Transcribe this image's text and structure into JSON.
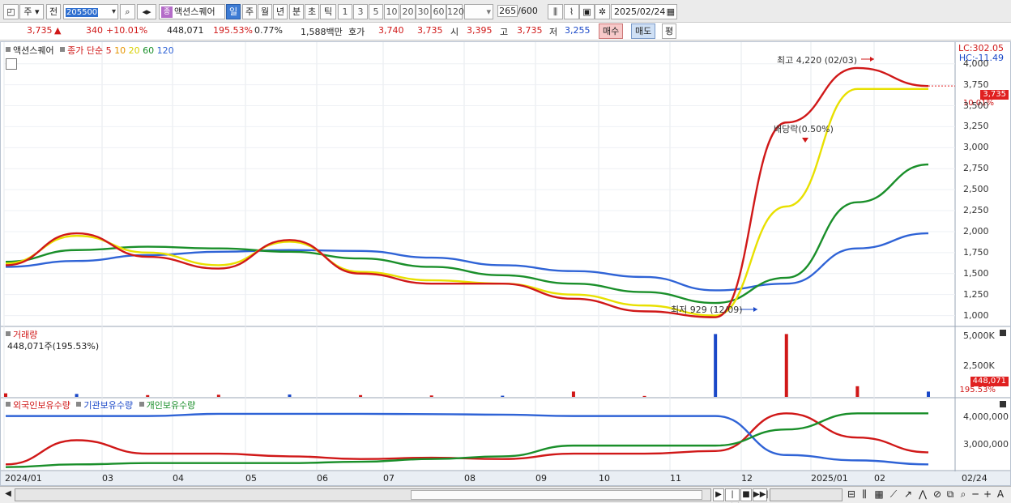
{
  "toolbar": {
    "market_label": "주",
    "prev_label": "전",
    "stock_code": "205500",
    "stock_name_tag": "종",
    "stock_name": "액션스퀘어",
    "periods": [
      "일",
      "주",
      "월",
      "년",
      "분",
      "초",
      "틱"
    ],
    "active_period": "일",
    "intervals": [
      "1",
      "3",
      "5",
      "10",
      "20",
      "30",
      "60",
      "120"
    ],
    "bar_count": "265",
    "bar_total": "/600",
    "date": "2025/02/24"
  },
  "quote": {
    "price": "3,735",
    "change": "340",
    "change_pct": "+10.01%",
    "volume": "448,071",
    "volume_ratio": "195.53%",
    "turnover_pct": "0.77%",
    "trade_value": "1,588백만",
    "hoga_label": "호가",
    "ask": "3,740",
    "bid": "3,735",
    "open_label": "시",
    "open": "3,395",
    "high_label": "고",
    "high": "3,735",
    "low_label": "저",
    "low": "3,255",
    "buy_label": "매수",
    "sell_label": "매도",
    "eval_label": "평"
  },
  "price_panel": {
    "stock_label": "액션스퀘어",
    "series_label": "종가 단순",
    "ma_labels": [
      {
        "label": "5",
        "color": "#d01818"
      },
      {
        "label": "10",
        "color": "#e59400"
      },
      {
        "label": "20",
        "color": "#e8e000"
      },
      {
        "label": "60",
        "color": "#1a8f2a"
      },
      {
        "label": "120",
        "color": "#2f63d6"
      }
    ],
    "lc_label": "LC:302.05",
    "hc_label": "HC:-11.49",
    "price_tag": "3,735",
    "pct_tag": "10.01%",
    "high_annotation": "최고 4,220 (02/03)",
    "low_annotation": "최저 929 (12/09)",
    "dividend_annotation": "배당락(0.50%)",
    "y_ticks": [
      "4,000",
      "3,750",
      "3,500",
      "3,250",
      "3,000",
      "2,750",
      "2,500",
      "2,250",
      "2,000",
      "1,750",
      "1,500",
      "1,250",
      "1,000"
    ]
  },
  "volume_panel": {
    "title": "거래량",
    "value_label": "448,071주(195.53%)",
    "y_ticks": [
      "5,000K",
      "2,500K"
    ],
    "tag_value": "448,071",
    "tag_pct": "195.53%"
  },
  "holding_panel": {
    "legend": [
      {
        "label": "외국인보유수량",
        "color": "#d01818"
      },
      {
        "label": "기관보유수량",
        "color": "#2f63d6"
      },
      {
        "label": "개인보유수량",
        "color": "#1a8f2a"
      }
    ],
    "y_ticks": [
      "4,000,000",
      "3,000,000"
    ]
  },
  "x_axis": {
    "labels": [
      "2024/01",
      "03",
      "04",
      "05",
      "06",
      "07",
      "08",
      "09",
      "10",
      "11",
      "12",
      "2025/01",
      "02"
    ],
    "end_label": "02/24"
  },
  "nav": {
    "arrows": [
      "◀",
      "▶",
      "|◀◀",
      "■",
      "▶▶|"
    ],
    "tools": [
      "─",
      "+",
      "A"
    ]
  },
  "chart_data": [
    {
      "type": "line",
      "title": "",
      "description_series": "daily close with moving averages",
      "x": [
        "2024/01",
        "03",
        "04",
        "05",
        "06",
        "07",
        "08",
        "09",
        "10",
        "11",
        "12",
        "2025/01",
        "02",
        "02/24"
      ],
      "series": [
        {
          "name": "5",
          "values": [
            1600,
            1980,
            1700,
            1560,
            1900,
            1500,
            1380,
            1380,
            1200,
            1050,
            980,
            3300,
            3950,
            3735
          ]
        },
        {
          "name": "20",
          "values": [
            1620,
            1950,
            1750,
            1600,
            1880,
            1520,
            1420,
            1380,
            1250,
            1120,
            1000,
            2300,
            3700,
            3700
          ]
        },
        {
          "name": "60",
          "values": [
            1640,
            1780,
            1820,
            1800,
            1760,
            1680,
            1580,
            1480,
            1380,
            1280,
            1150,
            1450,
            2350,
            2800
          ]
        },
        {
          "name": "120",
          "values": [
            1580,
            1650,
            1720,
            1760,
            1780,
            1770,
            1690,
            1600,
            1530,
            1460,
            1300,
            1380,
            1800,
            1980
          ]
        }
      ],
      "ylim": [
        880,
        4200
      ]
    },
    {
      "type": "bar",
      "title": "",
      "x": [
        "2024/01",
        "03",
        "04",
        "05",
        "06",
        "07",
        "08",
        "09",
        "10",
        "11",
        "12",
        "2025/01",
        "02",
        "02/24"
      ],
      "values": [
        300,
        250,
        150,
        180,
        200,
        150,
        120,
        100,
        450,
        80,
        5300,
        5300,
        900,
        448
      ]
    },
    {
      "type": "line",
      "title": "",
      "x": [
        "2024/01",
        "03",
        "04",
        "05",
        "06",
        "07",
        "08",
        "09",
        "10",
        "11",
        "12",
        "2025/01",
        "02",
        "02/24"
      ],
      "series": [
        {
          "name": "외국인보유수량",
          "values": [
            2400000,
            3300000,
            2800000,
            2800000,
            2700000,
            2600000,
            2650000,
            2600000,
            2800000,
            2800000,
            2900000,
            4300000,
            3400000,
            2850000
          ]
        },
        {
          "name": "기관보유수량",
          "values": [
            4200000,
            4200000,
            4200000,
            4280000,
            4280000,
            4280000,
            4270000,
            4250000,
            4200000,
            4200000,
            4200000,
            2750000,
            2550000,
            2400000
          ]
        },
        {
          "name": "개인보유수량",
          "values": [
            2300000,
            2400000,
            2450000,
            2450000,
            2450000,
            2500000,
            2600000,
            2700000,
            3100000,
            3100000,
            3100000,
            3700000,
            4300000,
            4300000
          ]
        }
      ],
      "ylim": [
        2200000,
        4550000
      ]
    }
  ]
}
